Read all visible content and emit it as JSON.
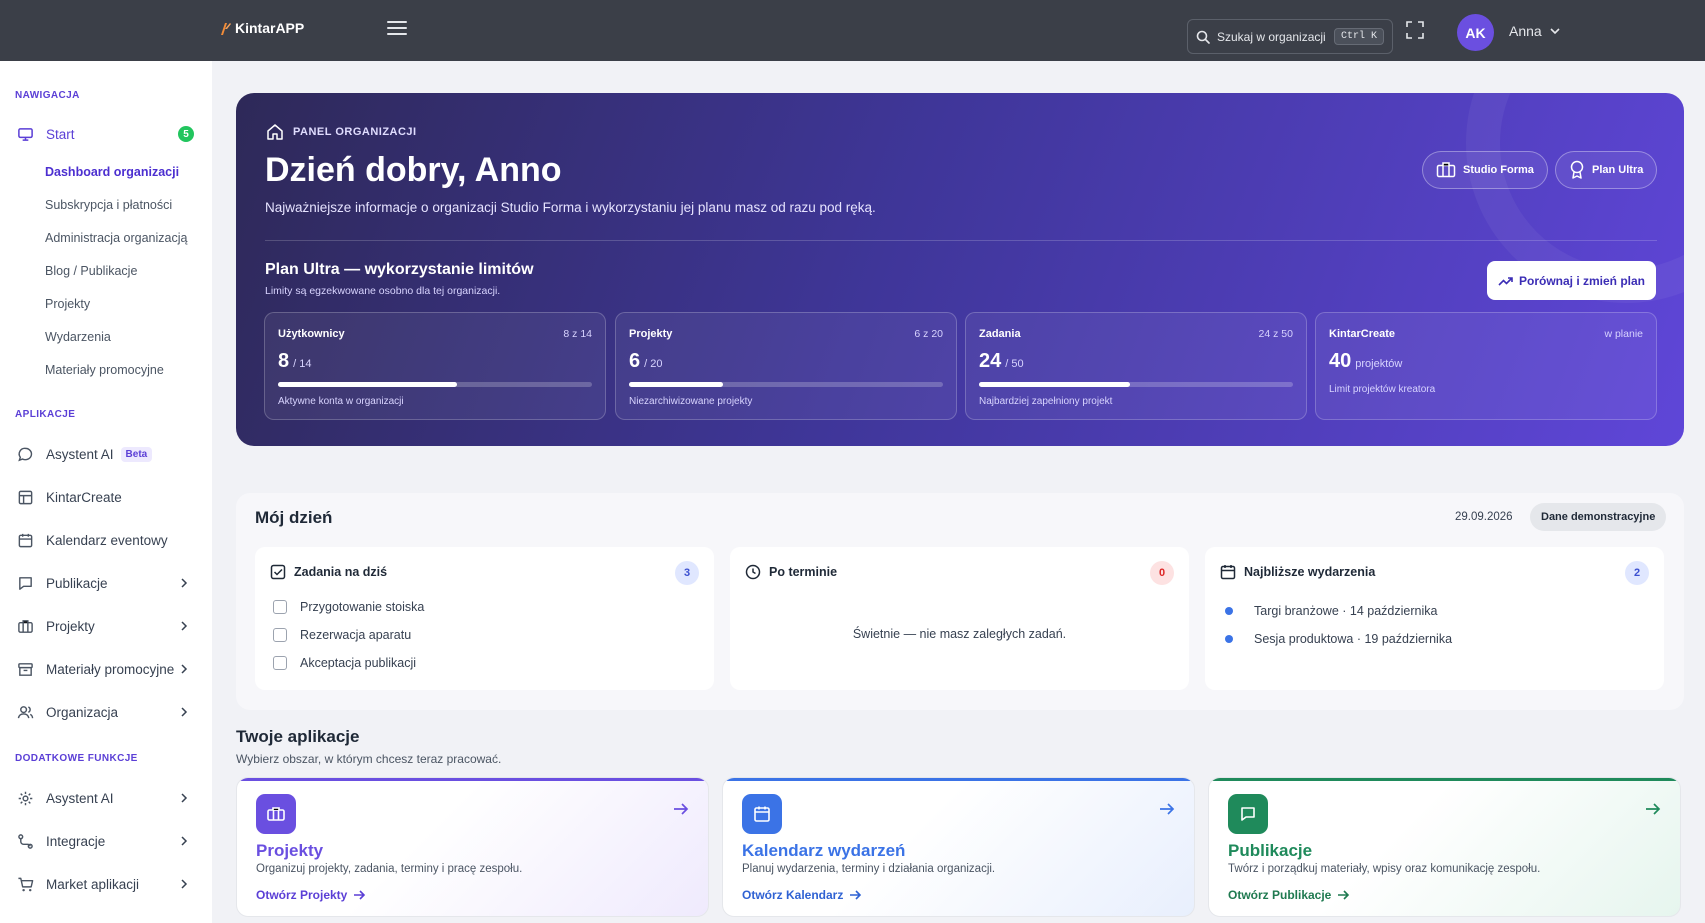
{
  "app": {
    "name": "KintarAPP"
  },
  "search": {
    "placeholder": "Szukaj w organizacji",
    "shortcut": "Ctrl K"
  },
  "user": {
    "initials": "AK",
    "name": "Anna"
  },
  "sidebar": {
    "sections": {
      "nav": "NAWIGACJA",
      "apps": "APLIKACJE",
      "extra": "DODATKOWE FUNKCJE"
    },
    "start": {
      "label": "Start",
      "badge": "5"
    },
    "start_sub": [
      "Dashboard organizacji",
      "Subskrypcja i płatności",
      "Administracja organizacją",
      "Blog / Publikacje",
      "Projekty",
      "Wydarzenia",
      "Materiały promocyjne"
    ],
    "apps": [
      {
        "label": "Asystent AI",
        "tag": "Beta",
        "icon": "chat-icon"
      },
      {
        "label": "KintarCreate",
        "icon": "layout-icon"
      },
      {
        "label": "Kalendarz eventowy",
        "icon": "calendar-icon"
      },
      {
        "label": "Publikacje",
        "icon": "message-icon"
      },
      {
        "label": "Projekty",
        "icon": "briefcase-icon"
      },
      {
        "label": "Materiały promocyjne",
        "icon": "archive-icon"
      },
      {
        "label": "Organizacja",
        "icon": "users-icon"
      }
    ],
    "extra": [
      {
        "label": "Asystent AI",
        "icon": "gear-icon"
      },
      {
        "label": "Integracje",
        "icon": "route-icon"
      },
      {
        "label": "Market aplikacji",
        "icon": "cart-icon"
      }
    ]
  },
  "hero": {
    "label": "PANEL ORGANIZACJI",
    "title": "Dzień dobry, Anno",
    "description": "Najważniejsze informacje o organizacji Studio Forma i wykorzystaniu jej planu masz od razu pod ręką.",
    "org_pill": "Studio Forma",
    "plan_pill": "Plan Ultra",
    "plan_title": "Plan Ultra — wykorzystanie limitów",
    "plan_subtitle": "Limity są egzekwowane osobno dla tej organizacji.",
    "compare_button": "Porównaj i zmień plan",
    "limits": [
      {
        "name": "Użytkownicy",
        "count": "8 z 14",
        "value": "8",
        "max": "/ 14",
        "fill": 0.571,
        "note": "Aktywne konta w organizacji"
      },
      {
        "name": "Projekty",
        "count": "6 z 20",
        "value": "6",
        "max": "/ 20",
        "fill": 0.3,
        "note": "Niezarchiwizowane projekty"
      },
      {
        "name": "Zadania",
        "count": "24 z 50",
        "value": "24",
        "max": "/ 50",
        "fill": 0.48,
        "note": "Najbardziej zapełniony projekt"
      },
      {
        "name": "KintarCreate",
        "count": "w planie",
        "value": "40",
        "max": "projektów",
        "note": "Limit projektów kreatora"
      }
    ]
  },
  "myday": {
    "title": "Mój dzień",
    "date": "29.09.2026",
    "demo_label": "Dane demonstracyjne",
    "tasks": {
      "title": "Zadania na dziś",
      "count": "3",
      "items": [
        "Przygotowanie stoiska",
        "Rezerwacja aparatu",
        "Akceptacja publikacji"
      ]
    },
    "overdue": {
      "title": "Po terminie",
      "count": "0",
      "empty": "Świetnie — nie masz zaległych zadań."
    },
    "events": {
      "title": "Najbliższe wydarzenia",
      "count": "2",
      "items": [
        "Targi branżowe · 14 października",
        "Sesja produktowa · 19 października"
      ]
    }
  },
  "apps": {
    "title": "Twoje aplikacje",
    "subtitle": "Wybierz obszar, w którym chcesz teraz pracować.",
    "items": [
      {
        "name": "Projekty",
        "desc": "Organizuj projekty, zadania, terminy i pracę zespołu.",
        "link": "Otwórz Projekty",
        "color": "#6a4fe0"
      },
      {
        "name": "Kalendarz wydarzeń",
        "desc": "Planuj wydarzenia, terminy i działania organizacji.",
        "link": "Otwórz Kalendarz",
        "color": "#3b73e6"
      },
      {
        "name": "Publikacje",
        "desc": "Twórz i porządkuj materiały, wpisy oraz komunikację zespołu.",
        "link": "Otwórz Publikacje",
        "color": "#1f8a5b"
      }
    ]
  },
  "colors": {
    "accent": "#5b3fd6",
    "topbar": "#3b3f48",
    "success": "#22c55e"
  }
}
